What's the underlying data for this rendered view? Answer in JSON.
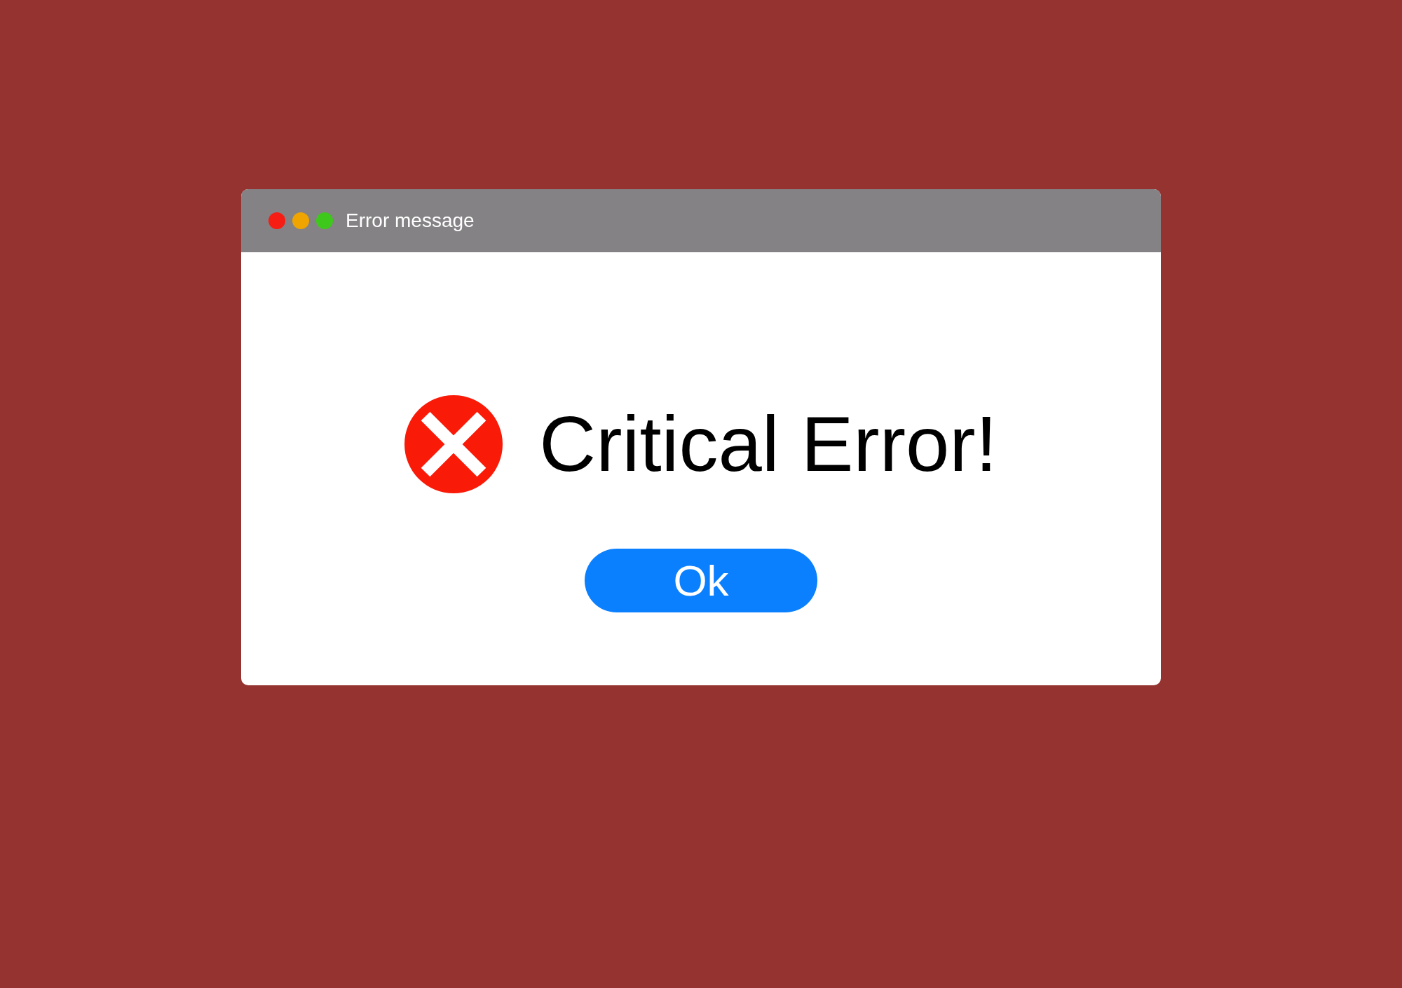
{
  "window": {
    "title": "Error message",
    "controls": [
      {
        "color": "#f61d14"
      },
      {
        "color": "#f0a400"
      },
      {
        "color": "#3fc81c"
      }
    ]
  },
  "message": {
    "kind": "error",
    "text": "Critical Error!"
  },
  "buttons": [
    {
      "label": "Ok"
    }
  ]
}
